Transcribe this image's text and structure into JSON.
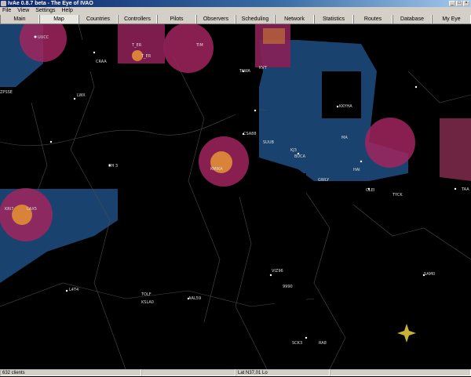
{
  "window": {
    "title": "IvAe 0.8.7 beta - The Eye of IVAO",
    "buttons": [
      "_",
      "□",
      "×"
    ]
  },
  "menu": {
    "items": [
      "File",
      "View",
      "Settings",
      "Help"
    ]
  },
  "tabs": [
    "Main",
    "Map",
    "Countries",
    "Controllers",
    "Pilots",
    "Observers",
    "Scheduling",
    "Network",
    "Statistics",
    "Routes",
    "Database",
    "My Eye"
  ],
  "active_tab": "Map",
  "map": {
    "colors": {
      "fir": "#1c4a7a",
      "approach": "#a0245e",
      "tower": "#d9823a",
      "label": "#dddddd",
      "line": "#555555"
    },
    "labels": [
      "UUCC",
      "T_ER",
      "T_ER",
      "TIM",
      "CRAA",
      "LWX",
      "TAWA",
      "KVT",
      "ZPSSE",
      "KKYHA",
      "CSA88",
      "SUUB",
      "KJ3",
      "BUCA",
      "KMIKA",
      "GWLY",
      "MA",
      "HAI",
      "OLEI",
      "CH 3",
      "TAA",
      "VIZ96",
      "KRI7",
      "LAX5",
      "SAM0",
      "L4T4",
      "TOLF",
      "AAL59",
      "KSLA0",
      "SCK3",
      "RA8",
      "TYCK",
      "9990"
    ]
  },
  "status": {
    "clients": "632 clients",
    "coordinates": "Lat N37,01 Lo"
  }
}
